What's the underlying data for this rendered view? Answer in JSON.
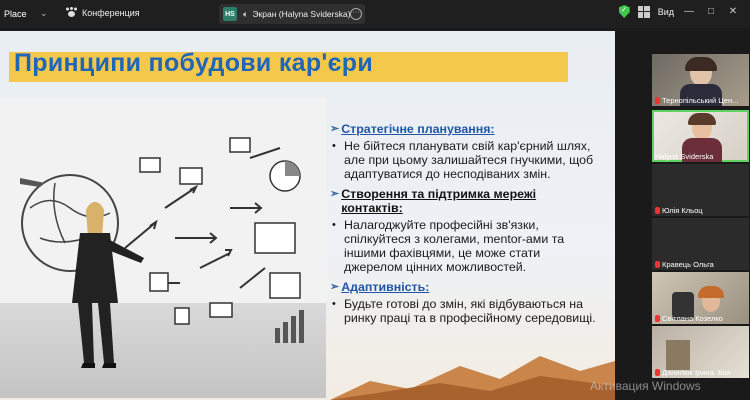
{
  "topbar": {
    "app_label": "Place",
    "chevron": "⌄",
    "conference_label": "Конференция",
    "share_initials": "HS",
    "share_label": "Экран (Halyna Sviderska)",
    "more_label": "···",
    "view_label": "Вид",
    "minimize": "—",
    "maximize": "□",
    "close": "✕"
  },
  "slide": {
    "title": "Принципи побудови кар'єри",
    "sections": [
      {
        "heading": "Стратегічне планування:",
        "heading_style": "blue",
        "bullet": "Не бійтеся планувати свій кар'єрний шлях, але при цьому залишайтеся гнучкими, щоб адаптуватися до несподіваних змін."
      },
      {
        "heading": "Створення та підтримка мережі контактів:",
        "heading_style": "black",
        "bullet": "Налагоджуйте професійні зв'язки, спілкуйтеся з колегами, mentor-ами та іншими фахівцями, це може стати джерелом цінних можливостей."
      },
      {
        "heading": "Адаптивність:",
        "heading_style": "blue",
        "bullet": "Будьте готові до змін, які відбуваються на ринку праці та в професійному середовищі."
      }
    ],
    "arrow_glyph": "➢",
    "bullet_glyph": "•"
  },
  "participants": [
    {
      "name": "Тернопільський Цен..."
    },
    {
      "name": "Halyna Sviderska"
    },
    {
      "name": "Юлія Кльоц"
    },
    {
      "name": "Кравець Ольга"
    },
    {
      "name": "Світлана Козелко"
    },
    {
      "name": "Данилюк Ірина. Бііл"
    }
  ],
  "watermark": "Активация Windows",
  "colors": {
    "title_color": "#1f66b8",
    "title_bar": "#f4c84a",
    "active_speaker": "#5fd35f"
  }
}
